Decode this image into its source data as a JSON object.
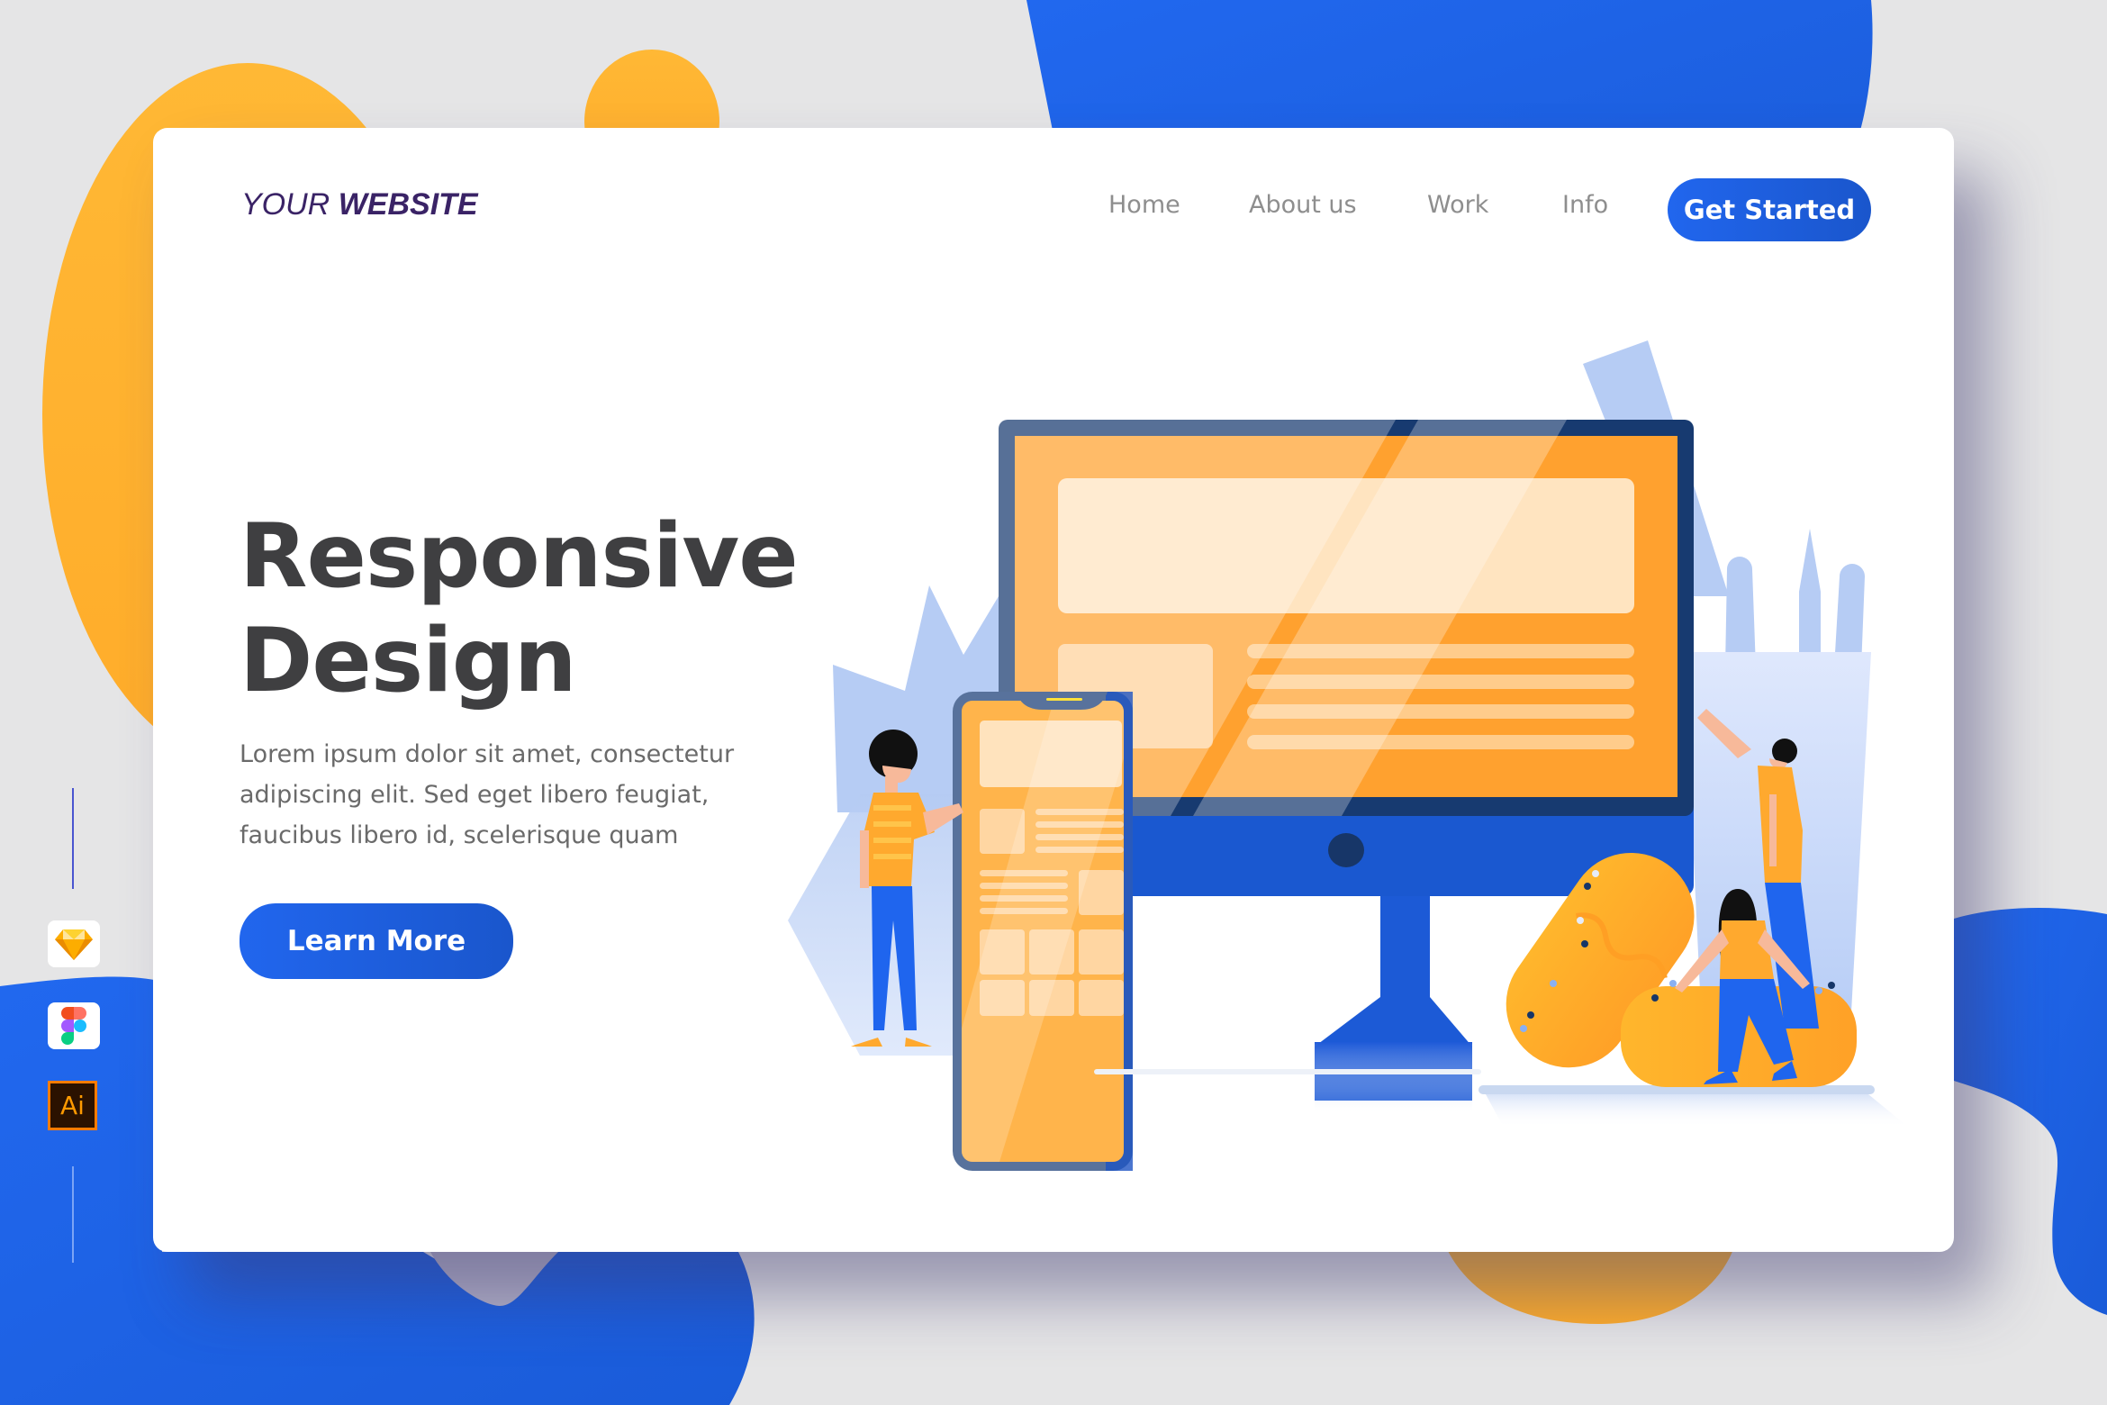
{
  "header": {
    "logo_prefix": "YOUR",
    "logo_suffix": "WEBSITE",
    "nav": [
      {
        "label": "Home"
      },
      {
        "label": "About us"
      },
      {
        "label": "Work"
      },
      {
        "label": "Info"
      }
    ],
    "cta_label": "Get Started"
  },
  "hero": {
    "title_line1": "Responsive",
    "title_line2": "Design",
    "description_lines": [
      "Lorem ipsum dolor sit amet, consectetur",
      "adipiscing elit. Sed eget libero feugiat,",
      "faucibus libero id, scelerisque quam"
    ],
    "button_label": "Learn More",
    "illustration": "responsive-design-devices-people-illustration"
  },
  "side_toolbar": {
    "icons": [
      {
        "name": "sketch-icon"
      },
      {
        "name": "figma-icon"
      },
      {
        "name": "illustrator-icon",
        "label": "Ai"
      }
    ]
  },
  "colors": {
    "background": "#e5e5e6",
    "primary_blue": "#1f66ee",
    "accent_orange": "#ffb22e",
    "logo_purple": "#3a2366",
    "heading": "#3f3f41",
    "body_text": "#6a6a6a",
    "nav_text": "#8e8e8e"
  }
}
